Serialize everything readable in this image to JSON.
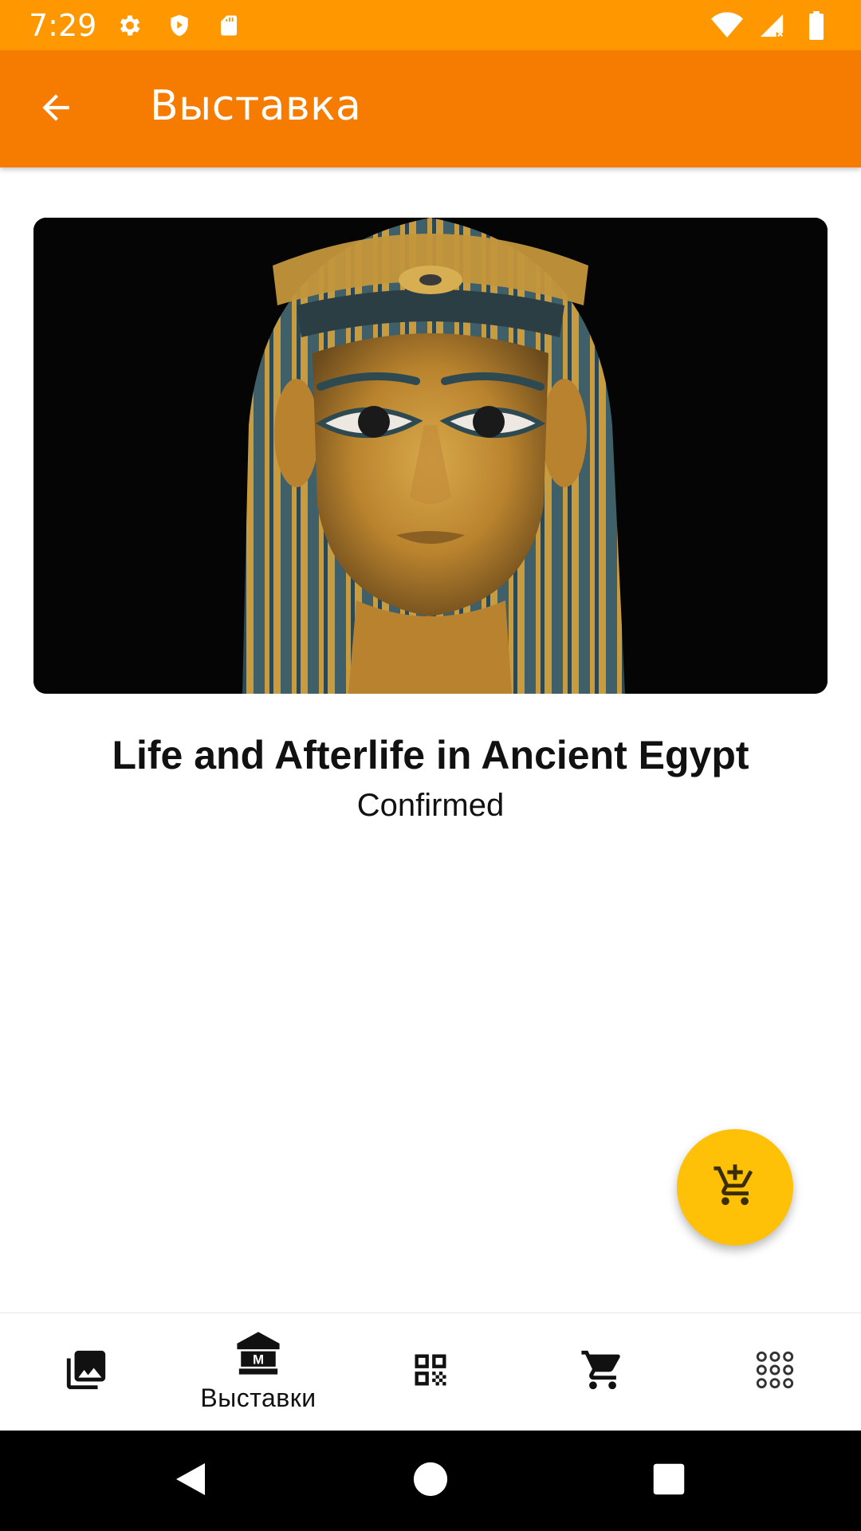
{
  "status_bar": {
    "time": "7:29",
    "left_icons": [
      "gear-icon",
      "shield-icon",
      "sd-card-icon"
    ],
    "right_icons": [
      "wifi-icon",
      "signal-icon",
      "battery-icon"
    ]
  },
  "app_bar": {
    "title": "Выставка",
    "back_icon": "arrow-back-icon",
    "background": "#F57C00"
  },
  "exhibit": {
    "image": "egyptian-mummy-mask-image",
    "title": "Life and Afterlife in Ancient Egypt",
    "status": "Confirmed"
  },
  "fab": {
    "icon": "add-shopping-cart-icon",
    "color": "#FFC107"
  },
  "bottom_nav": {
    "items": [
      {
        "icon": "photo-library-icon",
        "label": ""
      },
      {
        "icon": "museum-icon",
        "label": "Выставки",
        "active": true
      },
      {
        "icon": "qr-code-icon",
        "label": ""
      },
      {
        "icon": "shopping-cart-icon",
        "label": ""
      },
      {
        "icon": "apps-grid-icon",
        "label": ""
      }
    ]
  },
  "system_nav": {
    "buttons": [
      "back-triangle-icon",
      "home-circle-icon",
      "recents-square-icon"
    ]
  },
  "colors": {
    "status_bar": "#FF9800",
    "app_bar": "#F57C00",
    "fab": "#FFC107"
  }
}
